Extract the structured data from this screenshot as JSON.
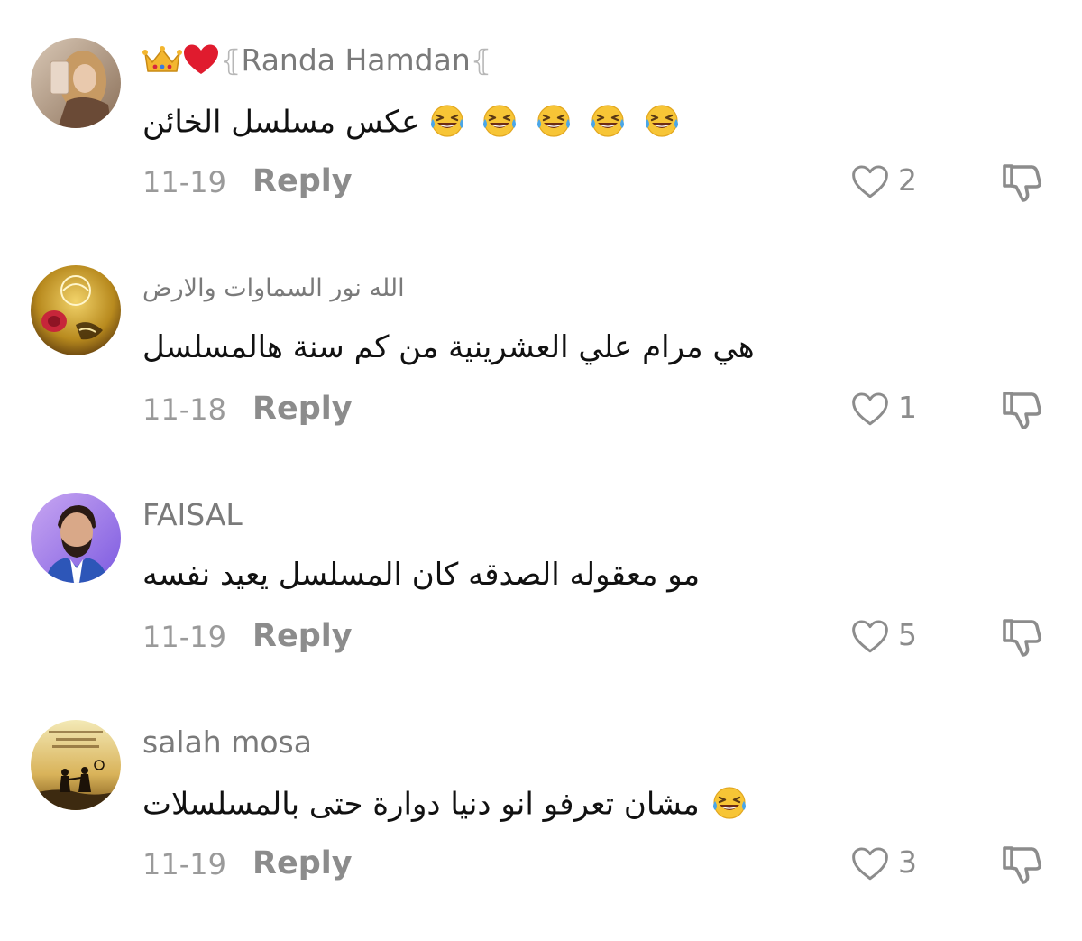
{
  "comments": [
    {
      "username": "Randa Hamdan",
      "username_prefix_icons": [
        "crown-emoji",
        "red-heart-emoji"
      ],
      "text": "عكس مسلسل الخائن",
      "text_emojis": [
        "laughing-tears-emoji",
        "laughing-tears-emoji",
        "laughing-tears-emoji",
        "laughing-tears-emoji",
        "laughing-tears-emoji"
      ],
      "date": "11-19",
      "reply_label": "Reply",
      "likes": "2"
    },
    {
      "username": "الله نور السماوات والارض",
      "text": "هي مرام علي العشرينية من كم سنة هالمسلسل",
      "date": "11-18",
      "reply_label": "Reply",
      "likes": "1"
    },
    {
      "username": "FAISAL",
      "text": "مو معقوله الصدقه كان المسلسل يعيد نفسه",
      "date": "11-19",
      "reply_label": "Reply",
      "likes": "5"
    },
    {
      "username": "salah mosa",
      "text": "مشان تعرفو انو دنيا دوارة حتى بالمسلسلات",
      "text_emojis": [
        "laughing-tears-emoji"
      ],
      "date": "11-19",
      "reply_label": "Reply",
      "likes": "3"
    }
  ],
  "icons": {
    "like": "heart-outline-icon",
    "dislike": "thumbs-down-icon"
  },
  "colors": {
    "meta_text": "#8c8c8c",
    "username": "#7a7a7a",
    "comment_text": "#111111",
    "icon_stroke": "#8c8c8c"
  }
}
